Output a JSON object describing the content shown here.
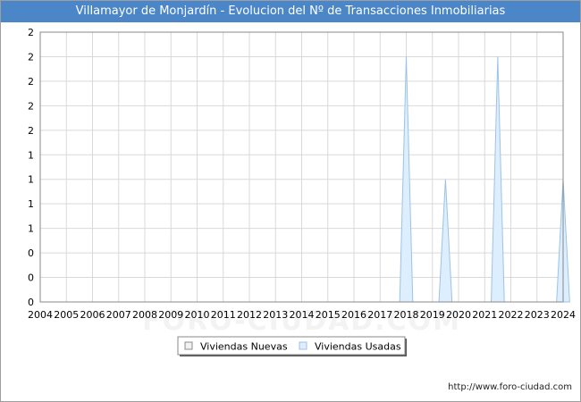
{
  "title": "Villamayor de Monjardín - Evolucion del Nº de Transacciones Inmobiliarias",
  "watermark": "FORO-CIUDAD.COM",
  "source_url": "http://www.foro-ciudad.com",
  "colors": {
    "title_bg": "#4a86c8",
    "nuevas_fill": "#f2f2f2",
    "nuevas_stroke": "#8c8c8c",
    "usadas_fill": "#ddeeff",
    "usadas_stroke": "#9cc3e6"
  },
  "chart_data": {
    "type": "area",
    "title": "Villamayor de Monjardín - Evolucion del Nº de Transacciones Inmobiliarias",
    "x": [
      2004,
      2005,
      2006,
      2007,
      2008,
      2009,
      2010,
      2011,
      2012,
      2013,
      2014,
      2015,
      2016,
      2017,
      2018,
      2019,
      2020,
      2021,
      2022,
      2023,
      2024
    ],
    "ylim": [
      0,
      2.2
    ],
    "y_ticks": [
      0,
      0.2,
      0.4,
      0.6,
      0.8,
      1.0,
      1.2,
      1.4,
      1.6,
      1.8,
      2.0,
      2.2
    ],
    "y_tick_labels": [
      "0",
      "0",
      "0",
      "1",
      "1",
      "1",
      "1",
      "2",
      "2",
      "2",
      "2",
      "2"
    ],
    "grid": true,
    "legend_position": "bottom-center",
    "series": [
      {
        "name": "Viviendas Nuevas",
        "points": []
      },
      {
        "name": "Viviendas Usadas",
        "points": [
          [
            2017.75,
            0
          ],
          [
            2018.0,
            2
          ],
          [
            2018.25,
            0
          ],
          [
            2019.25,
            0
          ],
          [
            2019.5,
            1
          ],
          [
            2019.75,
            0
          ],
          [
            2021.25,
            0
          ],
          [
            2021.5,
            2
          ],
          [
            2021.75,
            0
          ],
          [
            2023.75,
            0
          ],
          [
            2024.0,
            1
          ],
          [
            2024.25,
            0
          ]
        ]
      }
    ]
  }
}
